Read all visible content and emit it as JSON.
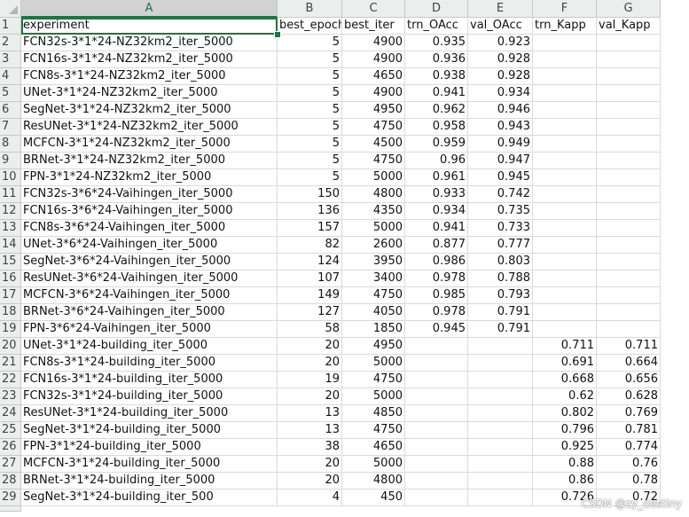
{
  "columns": [
    "A",
    "B",
    "C",
    "D",
    "E",
    "F",
    "G"
  ],
  "active_column": "A",
  "active_row": 1,
  "rows": [
    {
      "n": "1",
      "cells": [
        "experiment",
        "best_epoch",
        "best_iter",
        "trn_OAcc",
        "val_OAcc",
        "trn_Kapp",
        "val_Kapp"
      ]
    },
    {
      "n": "2",
      "cells": [
        "FCN32s-3*1*24-NZ32km2_iter_5000",
        "5",
        "4900",
        "0.935",
        "0.923",
        "",
        ""
      ]
    },
    {
      "n": "3",
      "cells": [
        "FCN16s-3*1*24-NZ32km2_iter_5000",
        "5",
        "4900",
        "0.936",
        "0.928",
        "",
        ""
      ]
    },
    {
      "n": "4",
      "cells": [
        "FCN8s-3*1*24-NZ32km2_iter_5000",
        "5",
        "4650",
        "0.938",
        "0.928",
        "",
        ""
      ]
    },
    {
      "n": "5",
      "cells": [
        "UNet-3*1*24-NZ32km2_iter_5000",
        "5",
        "4900",
        "0.941",
        "0.934",
        "",
        ""
      ]
    },
    {
      "n": "6",
      "cells": [
        "SegNet-3*1*24-NZ32km2_iter_5000",
        "5",
        "4950",
        "0.962",
        "0.946",
        "",
        ""
      ]
    },
    {
      "n": "7",
      "cells": [
        "ResUNet-3*1*24-NZ32km2_iter_5000",
        "5",
        "4750",
        "0.958",
        "0.943",
        "",
        ""
      ]
    },
    {
      "n": "8",
      "cells": [
        "MCFCN-3*1*24-NZ32km2_iter_5000",
        "5",
        "4500",
        "0.959",
        "0.949",
        "",
        ""
      ]
    },
    {
      "n": "9",
      "cells": [
        "BRNet-3*1*24-NZ32km2_iter_5000",
        "5",
        "4750",
        "0.96",
        "0.947",
        "",
        ""
      ]
    },
    {
      "n": "10",
      "cells": [
        "FPN-3*1*24-NZ32km2_iter_5000",
        "5",
        "5000",
        "0.961",
        "0.945",
        "",
        ""
      ]
    },
    {
      "n": "11",
      "cells": [
        "FCN32s-3*6*24-Vaihingen_iter_5000",
        "150",
        "4800",
        "0.933",
        "0.742",
        "",
        ""
      ]
    },
    {
      "n": "12",
      "cells": [
        "FCN16s-3*6*24-Vaihingen_iter_5000",
        "136",
        "4350",
        "0.934",
        "0.735",
        "",
        ""
      ]
    },
    {
      "n": "13",
      "cells": [
        "FCN8s-3*6*24-Vaihingen_iter_5000",
        "157",
        "5000",
        "0.941",
        "0.733",
        "",
        ""
      ]
    },
    {
      "n": "14",
      "cells": [
        "UNet-3*6*24-Vaihingen_iter_5000",
        "82",
        "2600",
        "0.877",
        "0.777",
        "",
        ""
      ]
    },
    {
      "n": "15",
      "cells": [
        "SegNet-3*6*24-Vaihingen_iter_5000",
        "124",
        "3950",
        "0.986",
        "0.803",
        "",
        ""
      ]
    },
    {
      "n": "16",
      "cells": [
        "ResUNet-3*6*24-Vaihingen_iter_5000",
        "107",
        "3400",
        "0.978",
        "0.788",
        "",
        ""
      ]
    },
    {
      "n": "17",
      "cells": [
        "MCFCN-3*6*24-Vaihingen_iter_5000",
        "149",
        "4750",
        "0.985",
        "0.793",
        "",
        ""
      ]
    },
    {
      "n": "18",
      "cells": [
        "BRNet-3*6*24-Vaihingen_iter_5000",
        "127",
        "4050",
        "0.978",
        "0.791",
        "",
        ""
      ]
    },
    {
      "n": "19",
      "cells": [
        "FPN-3*6*24-Vaihingen_iter_5000",
        "58",
        "1850",
        "0.945",
        "0.791",
        "",
        ""
      ]
    },
    {
      "n": "20",
      "cells": [
        "UNet-3*1*24-building_iter_5000",
        "20",
        "4950",
        "",
        "",
        "0.711",
        "0.711"
      ]
    },
    {
      "n": "21",
      "cells": [
        "FCN8s-3*1*24-building_iter_5000",
        "20",
        "5000",
        "",
        "",
        "0.691",
        "0.664"
      ]
    },
    {
      "n": "22",
      "cells": [
        "FCN16s-3*1*24-building_iter_5000",
        "19",
        "4750",
        "",
        "",
        "0.668",
        "0.656"
      ]
    },
    {
      "n": "23",
      "cells": [
        "FCN32s-3*1*24-building_iter_5000",
        "20",
        "5000",
        "",
        "",
        "0.62",
        "0.628"
      ]
    },
    {
      "n": "24",
      "cells": [
        "ResUNet-3*1*24-building_iter_5000",
        "13",
        "4850",
        "",
        "",
        "0.802",
        "0.769"
      ]
    },
    {
      "n": "25",
      "cells": [
        "SegNet-3*1*24-building_iter_5000",
        "13",
        "4750",
        "",
        "",
        "0.796",
        "0.781"
      ]
    },
    {
      "n": "26",
      "cells": [
        "FPN-3*1*24-building_iter_5000",
        "38",
        "4650",
        "",
        "",
        "0.925",
        "0.774"
      ]
    },
    {
      "n": "27",
      "cells": [
        "MCFCN-3*1*24-building_iter_5000",
        "20",
        "5000",
        "",
        "",
        "0.88",
        "0.76"
      ]
    },
    {
      "n": "28",
      "cells": [
        "BRNet-3*1*24-building_iter_5000",
        "20",
        "4800",
        "",
        "",
        "0.86",
        "0.78"
      ]
    },
    {
      "n": "29",
      "cells": [
        "SegNet-3*1*24-building_iter_500",
        "4",
        "450",
        "",
        "",
        "0.726",
        "0.72"
      ]
    }
  ],
  "watermark": "CSDN @zy_destiny",
  "colors": {
    "accent": "#217346",
    "header_bg": "#eceded",
    "grid": "#dadada"
  }
}
